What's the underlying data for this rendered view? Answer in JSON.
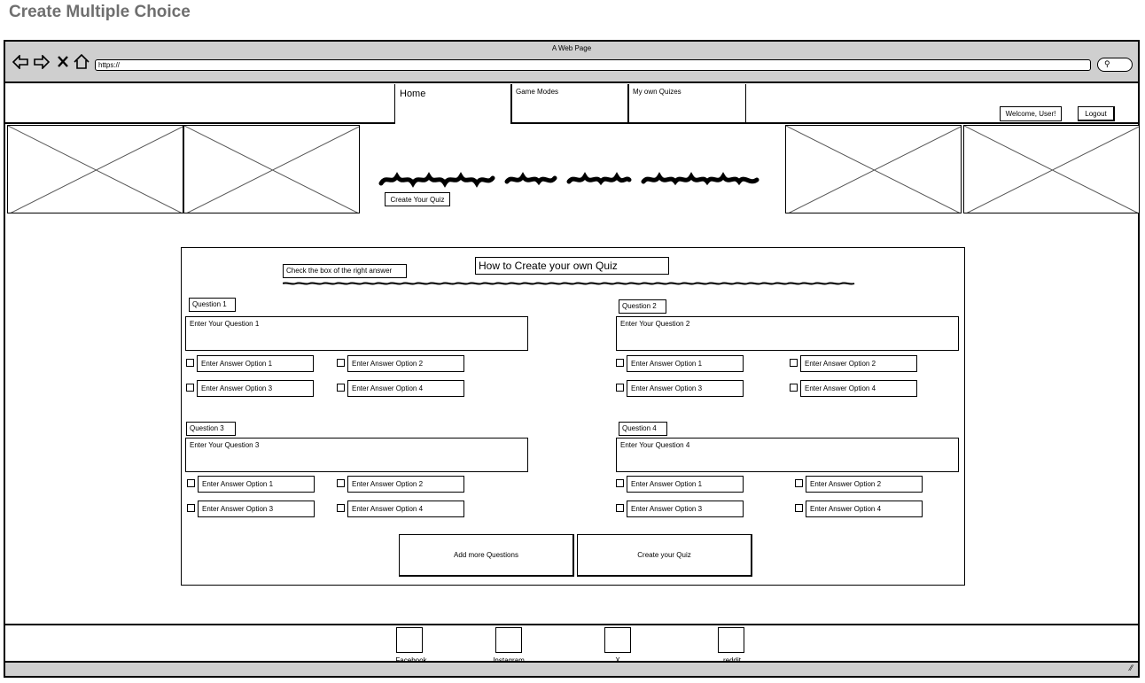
{
  "page": {
    "title": "Create Multiple Choice"
  },
  "browser": {
    "window_title": "A Web Page",
    "url": "https://",
    "icons": [
      "back-arrow-icon",
      "forward-arrow-icon",
      "close-icon",
      "home-icon",
      "search-icon"
    ]
  },
  "header": {
    "tabs": [
      {
        "label": "Home"
      },
      {
        "label": "Game Modes"
      },
      {
        "label": "My own Quizes"
      }
    ],
    "welcome": "Welcome, User!",
    "logout": "Logout"
  },
  "hero": {
    "create_quiz": "Create Your Quiz"
  },
  "form": {
    "title": "How to Create your own Quiz",
    "check_hint": "Check the box of the right answer",
    "questions": [
      {
        "label": "Question 1",
        "placeholder": "Enter Your Question 1",
        "options": [
          "Enter Answer Option 1",
          "Enter Answer Option 2",
          "Enter Answer Option 3",
          "Enter Answer Option 4"
        ]
      },
      {
        "label": "Question 2",
        "placeholder": "Enter Your Question 2",
        "options": [
          "Enter Answer Option 1",
          "Enter Answer Option 2",
          "Enter Answer Option 3",
          "Enter Answer Option 4"
        ]
      },
      {
        "label": "Question 3",
        "placeholder": "Enter Your Question 3",
        "options": [
          "Enter Answer Option 1",
          "Enter Answer Option 2",
          "Enter Answer Option 3",
          "Enter Answer Option 4"
        ]
      },
      {
        "label": "Question 4",
        "placeholder": "Enter Your Question 4",
        "options": [
          "Enter Answer Option 1",
          "Enter Answer Option 2",
          "Enter Answer Option 3",
          "Enter Answer Option 4"
        ]
      }
    ],
    "add_more": "Add more Questions",
    "create": "Create your Quiz"
  },
  "footer": {
    "social": [
      {
        "label": "Facebook"
      },
      {
        "label": "Instagram"
      },
      {
        "label": "X"
      },
      {
        "label": "reddit"
      }
    ]
  }
}
